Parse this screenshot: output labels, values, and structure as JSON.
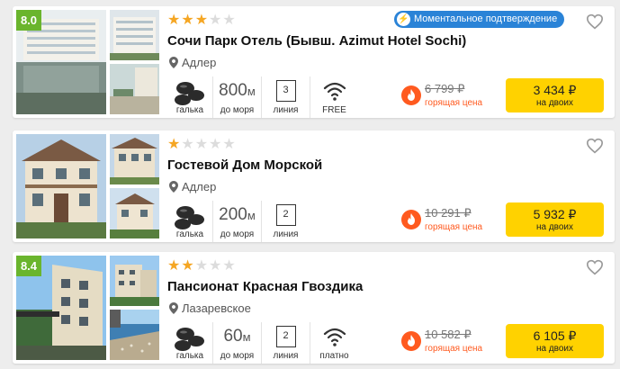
{
  "hotels": [
    {
      "rating": "8.0",
      "stars_filled": 3,
      "stars_total": 5,
      "badge": "Моментальное подтверждение",
      "name": "Сочи Парк Отель (Бывш. Azimut Hotel Sochi)",
      "location": "Адлер",
      "beach_type": "галька",
      "distance_value": "800",
      "distance_unit": "м",
      "distance_label": "до моря",
      "line_number": "3",
      "line_label": "линия",
      "wifi_label": "FREE",
      "old_price": "6 799 ₽",
      "hot_label": "горящая цена",
      "price": "3 434 ₽",
      "price_label": "на двоих"
    },
    {
      "rating": "",
      "stars_filled": 1,
      "stars_total": 5,
      "badge": "",
      "name": "Гостевой Дом Морской",
      "location": "Адлер",
      "beach_type": "галька",
      "distance_value": "200",
      "distance_unit": "м",
      "distance_label": "до моря",
      "line_number": "2",
      "line_label": "линия",
      "wifi_label": "",
      "old_price": "10 291 ₽",
      "hot_label": "горящая цена",
      "price": "5 932 ₽",
      "price_label": "на двоих"
    },
    {
      "rating": "8.4",
      "stars_filled": 2,
      "stars_total": 5,
      "badge": "",
      "name": "Пансионат Красная Гвоздика",
      "location": "Лазаревское",
      "beach_type": "галька",
      "distance_value": "60",
      "distance_unit": "м",
      "distance_label": "до моря",
      "line_number": "2",
      "line_label": "линия",
      "wifi_label": "платно",
      "old_price": "10 582 ₽",
      "hot_label": "горящая цена",
      "price": "6 105 ₽",
      "price_label": "на двоих"
    }
  ],
  "icons": {
    "heart": "heart-icon",
    "location": "location-pin-icon",
    "beach": "pebbles-icon",
    "wifi": "wifi-icon",
    "fire": "fire-icon",
    "bolt": "lightning-icon"
  },
  "colors": {
    "rating_bg": "#6ab52d",
    "star_on": "#f5a623",
    "star_off": "#dcdcdc",
    "badge_bg": "#2a83d7",
    "hot": "#ff5a1f",
    "price_btn": "#ffd200"
  }
}
